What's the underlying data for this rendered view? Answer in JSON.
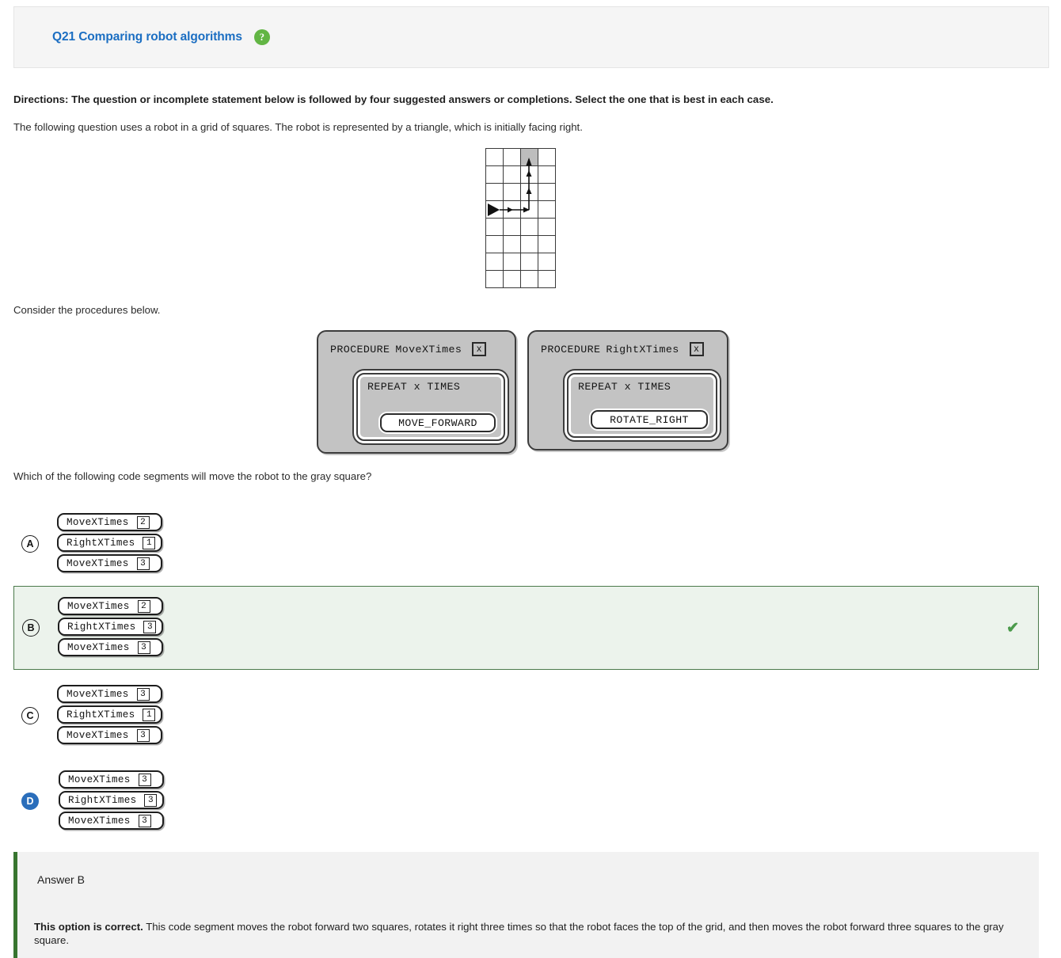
{
  "header": {
    "title": "Q21 Comparing robot algorithms",
    "help_icon": "help-question-icon",
    "help_glyph": "?"
  },
  "prompt": {
    "directions": "Directions: The question or incomplete statement below is followed by four suggested answers or completions. Select the one that is best in each case.",
    "intro": "The following question uses a robot in a grid of squares. The robot is represented by a triangle, which is initially facing right.",
    "consider": "Consider the procedures below.",
    "question": "Which of the following code segments will move the robot to the gray square?"
  },
  "grid": {
    "columns": 4,
    "rows": 8,
    "gray_square": {
      "col": 3,
      "row": 1
    },
    "robot": {
      "col": 1,
      "row": 4,
      "facing": "right"
    },
    "path": "right 2 squares, then up 3 squares"
  },
  "procedures": [
    {
      "keyword": "PROCEDURE",
      "name": "MoveXTimes",
      "param": "x",
      "repeat_label": "REPEAT x TIMES",
      "statement": "MOVE_FORWARD"
    },
    {
      "keyword": "PROCEDURE",
      "name": "RightXTimes",
      "param": "x",
      "repeat_label": "REPEAT x TIMES",
      "statement": "ROTATE_RIGHT"
    }
  ],
  "choices": [
    {
      "letter": "A",
      "selected": false,
      "correct": false,
      "lines": [
        {
          "call": "MoveXTimes",
          "arg": "2"
        },
        {
          "call": "RightXTimes",
          "arg": "1"
        },
        {
          "call": "MoveXTimes",
          "arg": "3"
        }
      ]
    },
    {
      "letter": "B",
      "selected": false,
      "correct": true,
      "check_glyph": "✔",
      "lines": [
        {
          "call": "MoveXTimes",
          "arg": "2"
        },
        {
          "call": "RightXTimes",
          "arg": "3"
        },
        {
          "call": "MoveXTimes",
          "arg": "3"
        }
      ]
    },
    {
      "letter": "C",
      "selected": false,
      "correct": false,
      "lines": [
        {
          "call": "MoveXTimes",
          "arg": "3"
        },
        {
          "call": "RightXTimes",
          "arg": "1"
        },
        {
          "call": "MoveXTimes",
          "arg": "3"
        }
      ]
    },
    {
      "letter": "D",
      "selected": true,
      "correct": false,
      "lines": [
        {
          "call": "MoveXTimes",
          "arg": "3"
        },
        {
          "call": "RightXTimes",
          "arg": "3"
        },
        {
          "call": "MoveXTimes",
          "arg": "3"
        }
      ]
    }
  ],
  "answer": {
    "heading": "Answer B",
    "verdict": "This option is correct.",
    "explanation": " This code segment moves the robot forward two squares, rotates it right three times so that the robot faces the top of the grid, and then moves the robot forward three squares to the gray square."
  },
  "colors": {
    "title_blue": "#1b6ec2",
    "help_green": "#62b544",
    "highlight_bg": "#ecf3ec",
    "highlight_border": "#4b7a4b",
    "selected_blue": "#2a6ebb",
    "accent_green": "#38752f",
    "gray_square": "#bdbdbd"
  }
}
